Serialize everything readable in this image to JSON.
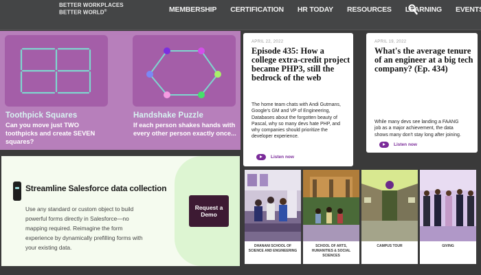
{
  "header": {
    "logo_line1": "BETTER WORKPLACES",
    "logo_line2": "BETTER WORLD",
    "logo_mark": "®",
    "nav": [
      "MEMBERSHIP",
      "CERTIFICATION",
      "HR TODAY",
      "RESOURCES",
      "LEARNING",
      "EVENTS"
    ],
    "search_icon": "search-icon"
  },
  "puzzles": [
    {
      "title": "Toothpick Squares",
      "description": "Can you move just TWO toothpicks and create SEVEN squares?"
    },
    {
      "title": "Handshake Puzzle",
      "description": "If each person shakes hands with every other person exactly once..."
    }
  ],
  "podcasts": [
    {
      "date": "APRIL 22, 2022",
      "title": "Episode 435: How a college extra-credit project became PHP3, still the bedrock of the web",
      "description": "The home team chats with Andi Gutmans, Google's GM and VP of Engineering, Databases about the forgotten beauty of Pascal, why so many devs hate PHP, and why companies should prioritize the developer experience.",
      "listen": "Listen now"
    },
    {
      "date": "APRIL 19, 2022",
      "title": "What's the average tenure of an engineer at a big tech company? (Ep. 434)",
      "description": "While many devs see landing a FAANG job as a major achievement, the data shows many don't stay long after joining.",
      "listen": "Listen now"
    }
  ],
  "ad": {
    "title": "Streamline Salesforce data collection",
    "body": "Use any standard or custom object to build powerful forms directly in Salesforce—no mapping required. Reimagine the form experience by dynamically prefilling forms with your existing data.",
    "button": "Request a Demo"
  },
  "campus": [
    {
      "label": "DHANANI SCHOOL OF SCIENCE AND ENGINEERING"
    },
    {
      "label": "SCHOOL OF ARTS, HUMANITIES & SOCIAL SCIENCES"
    },
    {
      "label": "CAMPUS TOUR"
    },
    {
      "label": "GIVING"
    }
  ],
  "colors": {
    "header_bg": "#444546",
    "puzzle_bg": "#b77fbb",
    "puzzle_card": "#a45ea8",
    "accent_purple": "#7a2a99",
    "ad_button": "#3d1a33"
  }
}
